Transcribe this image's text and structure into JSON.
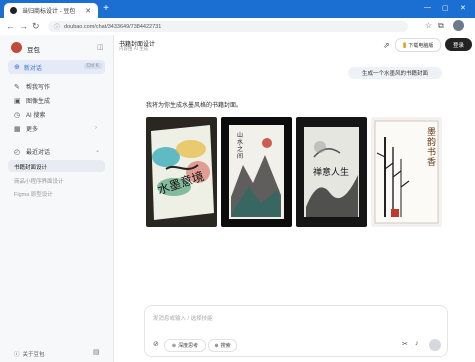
{
  "browser": {
    "tab_title": "当归商标设计 - 豆包",
    "new_tab": "+",
    "win_min": "—",
    "win_max": "▢",
    "win_close": "✕",
    "back": "←",
    "forward": "→",
    "reload": "↻",
    "url": "doubao.com/chat/3433649/7384422731",
    "lock": "ⓘ",
    "star": "☆",
    "ext": "⧉"
  },
  "sidebar": {
    "brand": "豆包",
    "collapse": "◫",
    "new_chat": "新对话",
    "new_chat_key": "Ctrl K",
    "items": [
      {
        "icon": "✎",
        "label": "帮我写作"
      },
      {
        "icon": "▣",
        "label": "图像生成"
      },
      {
        "icon": "◷",
        "label": "AI 搜索"
      },
      {
        "icon": "▦",
        "label": "更多"
      }
    ],
    "history_title": "最近对话",
    "history_icon": "◴",
    "history": [
      "书籍封面设计",
      "商品小程序界面设计",
      "Figma 原型设计"
    ],
    "about": "关于豆包",
    "about_icon": "ⓘ",
    "bottom_icon": "▤"
  },
  "header": {
    "title": "书籍封面设计",
    "subtitle": "内容由 AI 生成",
    "share_icon": "⇗",
    "download": "下载电脑版",
    "login": "登录"
  },
  "chat": {
    "user_msg": "生成一个水墨风的书籍封面",
    "reply": "我将为你生成水墨风格的书籍封面。",
    "covers": [
      {
        "title": "水墨意境"
      },
      {
        "title": "山水之间"
      },
      {
        "title": "禅意人生"
      },
      {
        "title": "墨韵书香"
      }
    ]
  },
  "composer": {
    "placeholder": "发消息或输入 / 选择技能",
    "attach_icon": "⊘",
    "deep_think": "深度思考",
    "search": "搜索",
    "scissors_icon": "✂",
    "mic_icon": "🎤"
  }
}
